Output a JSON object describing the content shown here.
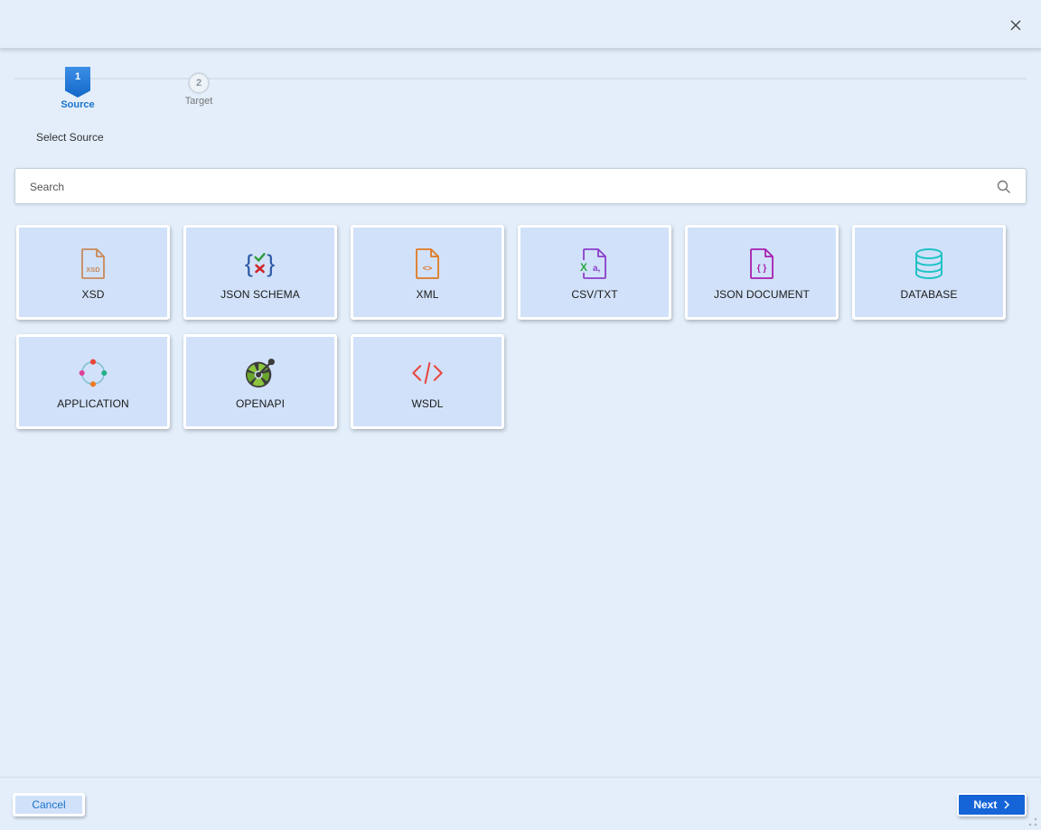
{
  "dialog": {
    "close_icon": "close-icon"
  },
  "stepper": {
    "steps": [
      {
        "number": "1",
        "label": "Source",
        "state": "active"
      },
      {
        "number": "2",
        "label": "Target",
        "state": "inactive"
      }
    ]
  },
  "section": {
    "title": "Select Source"
  },
  "search": {
    "placeholder": "Search",
    "value": "",
    "icon": "search-icon"
  },
  "sources": [
    {
      "label": "XSD",
      "icon": "xsd-file-icon"
    },
    {
      "label": "JSON SCHEMA",
      "icon": "json-schema-icon"
    },
    {
      "label": "XML",
      "icon": "xml-file-icon"
    },
    {
      "label": "CSV/TXT",
      "icon": "csv-file-icon"
    },
    {
      "label": "JSON DOCUMENT",
      "icon": "json-document-icon"
    },
    {
      "label": "DATABASE",
      "icon": "database-icon"
    },
    {
      "label": "APPLICATION",
      "icon": "application-icon"
    },
    {
      "label": "OPENAPI",
      "icon": "openapi-icon"
    },
    {
      "label": "WSDL",
      "icon": "wsdl-code-icon"
    }
  ],
  "footer": {
    "cancel_label": "Cancel",
    "next_label": "Next"
  },
  "colors": {
    "accent": "#1565d8",
    "background": "#e3eefa",
    "tile": "#d1e1f9"
  }
}
